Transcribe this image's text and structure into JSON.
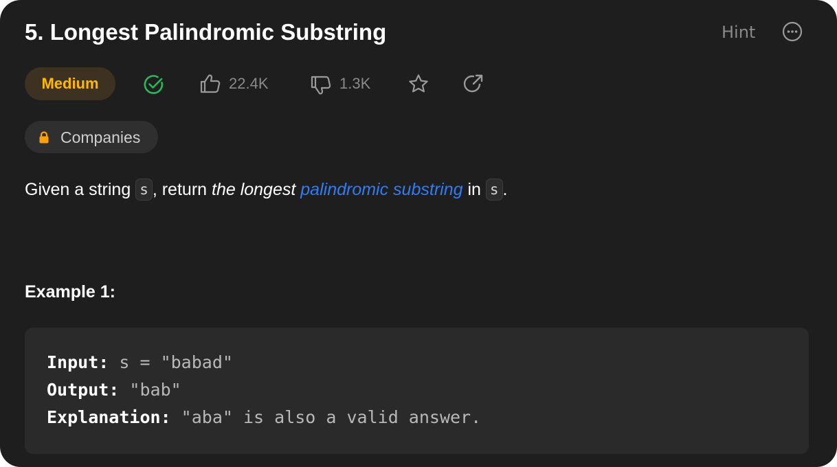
{
  "problem": {
    "title": "5. Longest Palindromic Substring",
    "hint_label": "Hint",
    "difficulty": "Medium",
    "likes": "22.4K",
    "dislikes": "1.3K",
    "companies_label": "Companies"
  },
  "description": {
    "part1": "Given a string ",
    "code1": "s",
    "part2": ", return ",
    "emphasis": "the longest",
    "space": " ",
    "link_text": "palindromic substring",
    "part3": " in ",
    "code2": "s",
    "part4": "."
  },
  "example": {
    "title": "Example 1:",
    "input_label": "Input:",
    "input_value": " s = \"babad\"",
    "output_label": "Output:",
    "output_value": " \"bab\"",
    "explanation_label": "Explanation:",
    "explanation_value": " \"aba\" is also a valid answer."
  },
  "colors": {
    "background": "#1e1e1e",
    "difficulty_medium": "#ffb800",
    "solved_check": "#2db55d",
    "link": "#2f7cf6",
    "lock": "#ff9f0a"
  },
  "icons": [
    "solved-check-icon",
    "thumbs-up-icon",
    "thumbs-down-icon",
    "star-icon",
    "share-icon",
    "more-options-icon",
    "lock-icon"
  ]
}
